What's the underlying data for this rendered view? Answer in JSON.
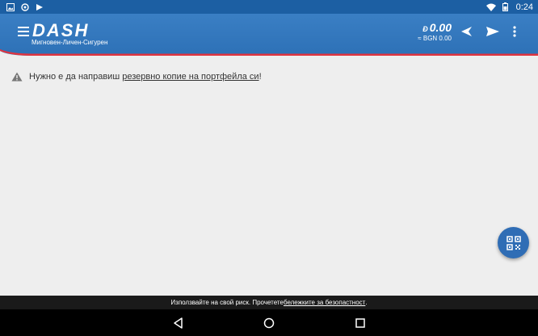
{
  "status_bar": {
    "time": "0:24",
    "left_icons": [
      "image-notification-icon",
      "settings-notification-icon",
      "store-notification-icon"
    ],
    "right_icons": [
      "wifi-icon",
      "battery-icon"
    ]
  },
  "header": {
    "logo": "DASH",
    "tagline": "Мигновен-Личен-Сигурен",
    "balance": "0.00",
    "balance_prefix": "Đ",
    "fiat_balance": "≈ BGN 0.00",
    "colors": {
      "bar": "#2c6fb5",
      "stripe": "#e0343f",
      "status_bar": "#1c5fa3"
    }
  },
  "warning": {
    "prefix": "Нужно е да направиш ",
    "link": "резервно копие на портфейла си",
    "suffix": "!"
  },
  "footer": {
    "prefix": "Използвайте на свой риск. Прочетете ",
    "link": "бележките за безопастност",
    "suffix": "."
  },
  "fab": {
    "icon": "qr-code-icon",
    "accent": "#2f6db5"
  },
  "nav": {
    "icons": [
      "back-icon",
      "home-icon",
      "recent-apps-icon"
    ]
  }
}
